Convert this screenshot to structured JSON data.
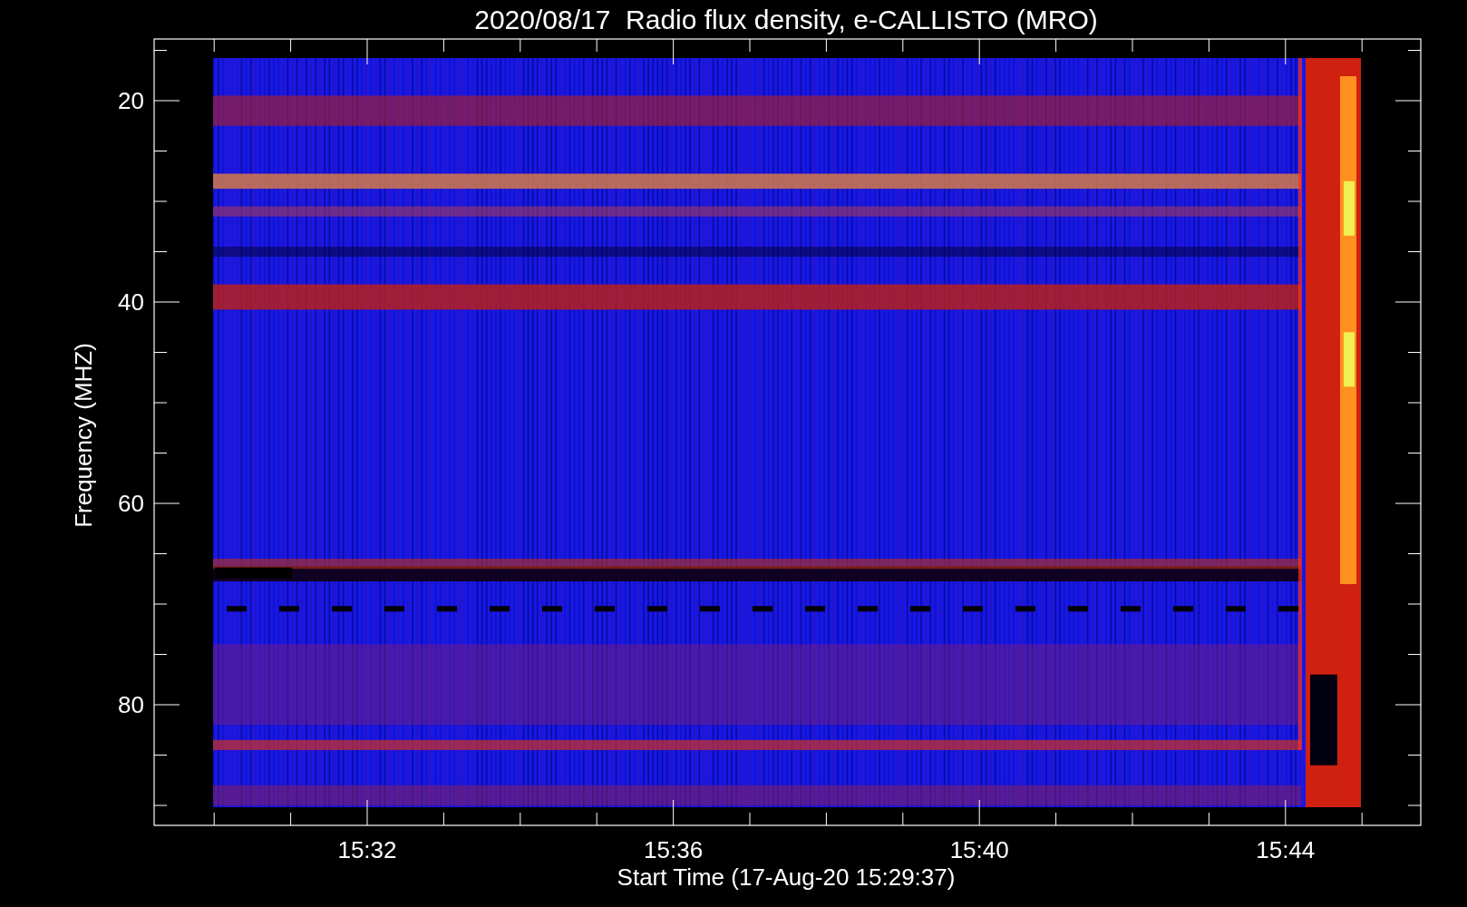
{
  "title": "2020/08/17  Radio flux density, e-CALLISTO (MRO)",
  "plot": {
    "ylabel": "Frequency (MHZ)",
    "xlabel": "Start Time (17-Aug-20 15:29:37)",
    "yticks": [
      "20",
      "40",
      "60",
      "80"
    ],
    "xticks": [
      "15:32",
      "15:36",
      "15:40",
      "15:44"
    ]
  }
}
